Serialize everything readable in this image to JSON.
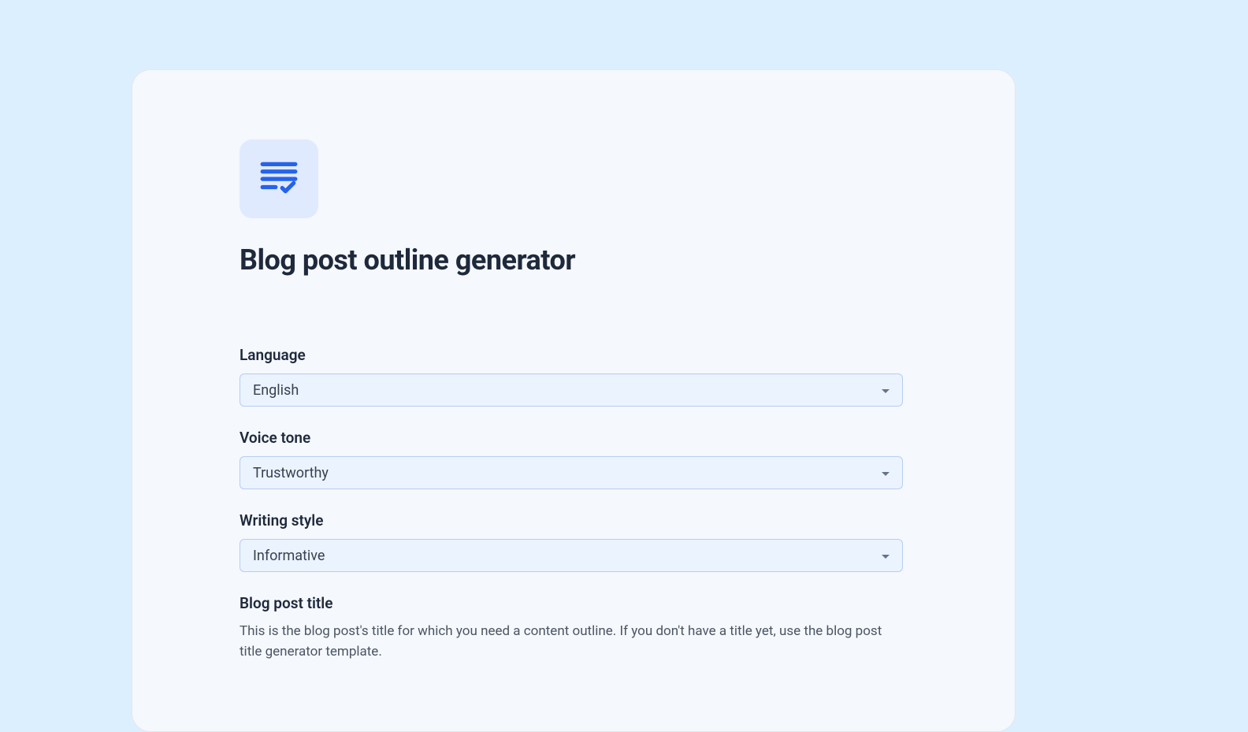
{
  "title": "Blog post outline generator",
  "fields": {
    "language": {
      "label": "Language",
      "value": "English"
    },
    "voiceTone": {
      "label": "Voice tone",
      "value": "Trustworthy"
    },
    "writingStyle": {
      "label": "Writing style",
      "value": "Informative"
    },
    "blogTitle": {
      "label": "Blog post title",
      "description": "This is the blog post's title for which you need a content outline. If you don't have a title yet, use the blog post title generator template."
    }
  }
}
